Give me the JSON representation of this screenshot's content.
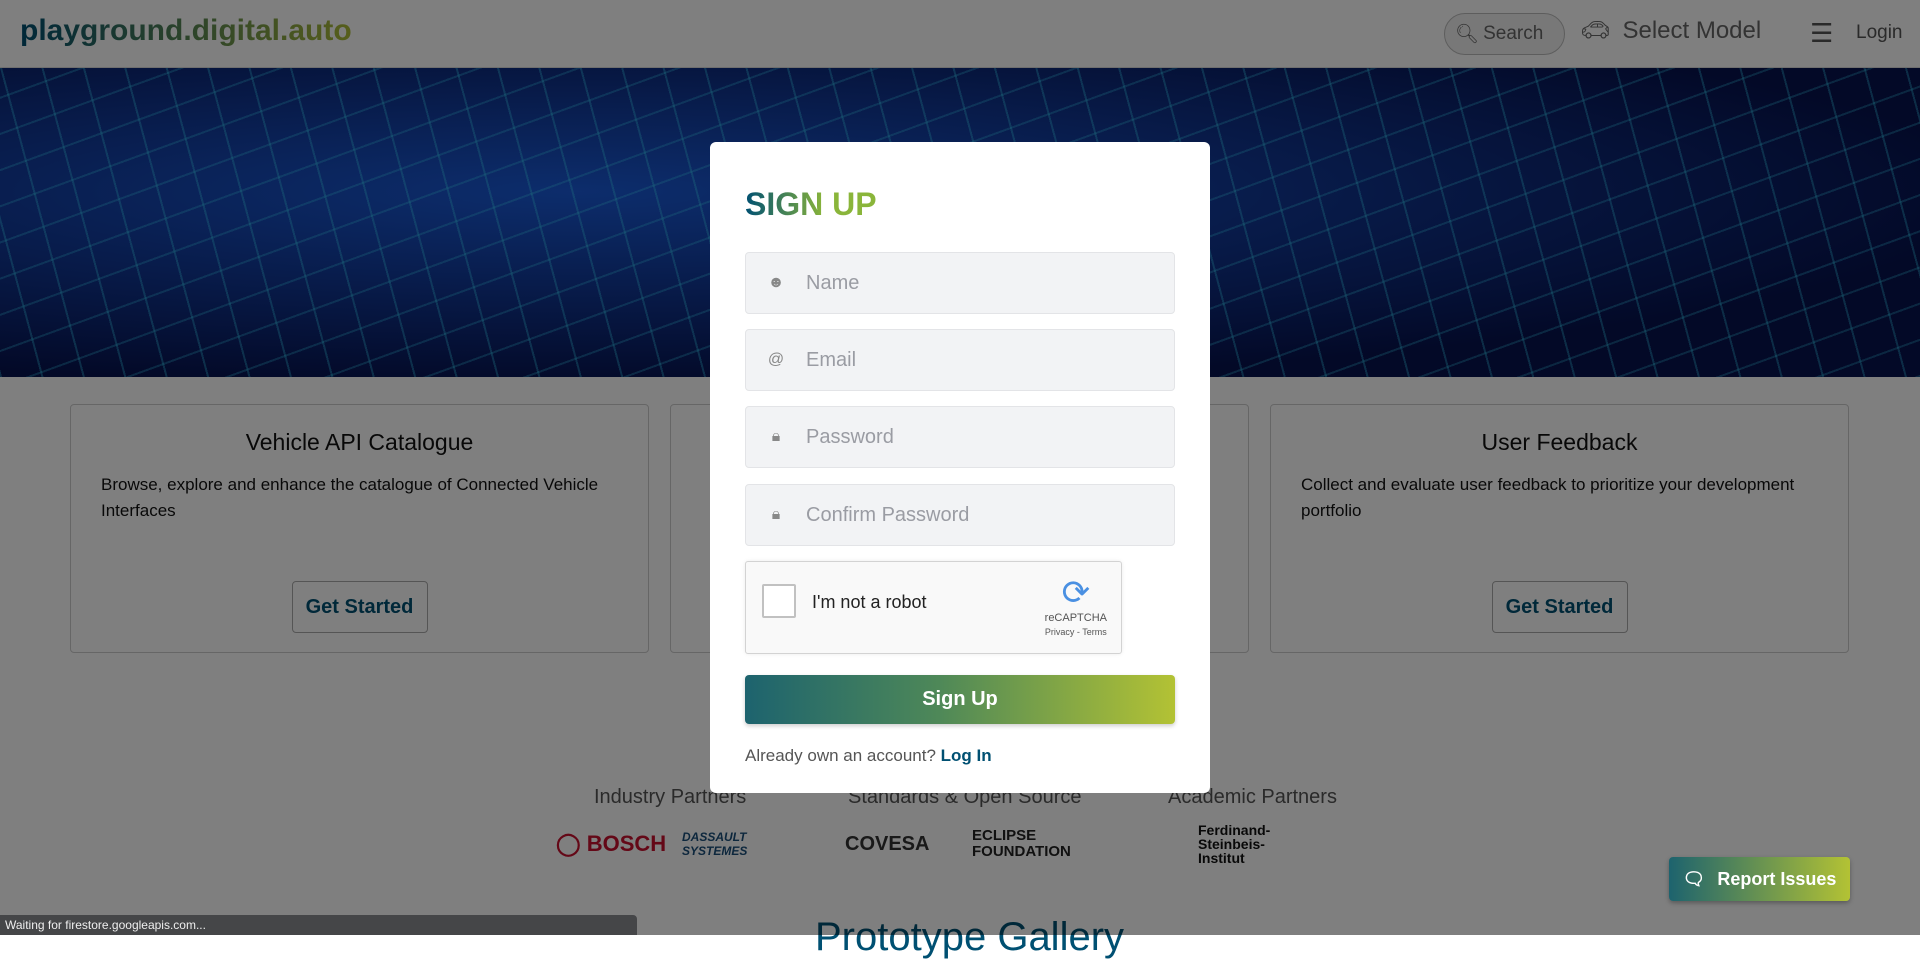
{
  "header": {
    "logo": "playground.digital.auto",
    "search": "Search",
    "select_model": "Select Model",
    "login": "Login"
  },
  "cards": [
    {
      "title": "Vehicle API Catalogue",
      "description": "Browse, explore and enhance the catalogue of Connected Vehicle Interfaces",
      "button": "Get Started"
    },
    {
      "title": "",
      "description": "",
      "button": ""
    },
    {
      "title": "User Feedback",
      "description": "Collect and evaluate user feedback to prioritize your development portfolio",
      "button": "Get Started"
    }
  ],
  "partners": {
    "industry": "Industry Partners",
    "standards": "Standards & Open Source",
    "academic": "Academic Partners",
    "logos": [
      "BOSCH",
      "DASSAULT SYSTEMES",
      "COVESA",
      "ECLIPSE FOUNDATION",
      "Ferdinand-Steinbeis-Institut"
    ]
  },
  "gallery_title": "Prototype Gallery",
  "modal": {
    "title": "SIGN UP",
    "name_placeholder": "Name",
    "email_placeholder": "Email",
    "password_placeholder": "Password",
    "confirm_placeholder": "Confirm Password",
    "captcha_label": "I'm not a robot",
    "captcha_brand": "reCAPTCHA",
    "captcha_links": "Privacy - Terms",
    "submit": "Sign Up",
    "already": "Already own an account?",
    "login_link": "Log In"
  },
  "report_issues": "Report Issues",
  "status_text": "Waiting for firestore.googleapis.com...",
  "colors": {
    "brand_start": "#005072",
    "brand_end": "#aebd38"
  }
}
